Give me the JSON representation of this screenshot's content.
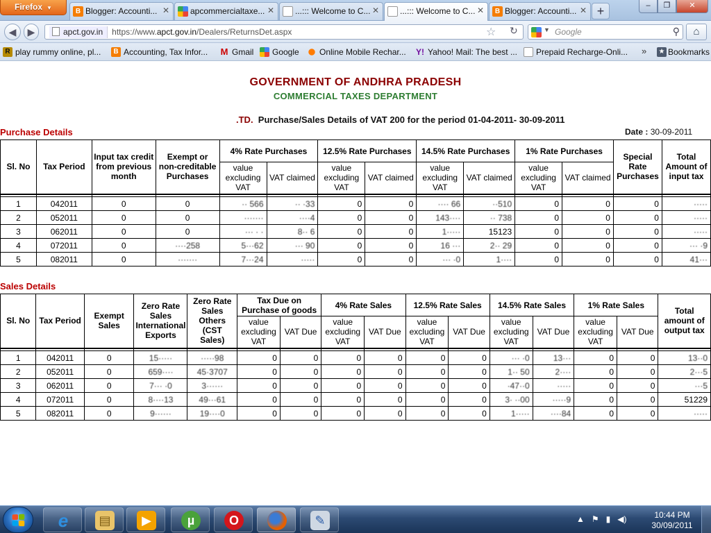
{
  "browser": {
    "app_button": "Firefox",
    "tabs": [
      {
        "label": "Blogger: Accounti...",
        "icon": "blogger-icon",
        "close": "✕"
      },
      {
        "label": "apcommercialtaxe...",
        "icon": "google-icon",
        "close": "✕"
      },
      {
        "label": "...::: Welcome to C...",
        "icon": "page-icon",
        "close": "✕"
      },
      {
        "label": "...::: Welcome to C...",
        "icon": "page-icon",
        "close": "✕",
        "active": true
      },
      {
        "label": "Blogger: Accounti...",
        "icon": "blogger-icon",
        "close": "✕"
      }
    ],
    "new_tab": "+",
    "site_identity": "apct.gov.in",
    "url_prefix": "https://www.",
    "url_domain": "apct.gov.in",
    "url_path": "/Dealers/ReturnsDet.aspx",
    "search_placeholder": "Google",
    "bookmarks": [
      {
        "label": "play rummy online, pl...",
        "icon": "R"
      },
      {
        "label": "Accounting, Tax Infor...",
        "icon": "B"
      },
      {
        "label": "Gmail",
        "icon": "M"
      },
      {
        "label": "Google",
        "icon": "g"
      },
      {
        "label": "Online Mobile Rechar...",
        "icon": "o"
      },
      {
        "label": "Yahoo! Mail: The best ...",
        "icon": "Y!"
      },
      {
        "label": "Prepaid Recharge-Onli...",
        "icon": "pg"
      }
    ],
    "bookmarks_overflow": "»",
    "bookmarks_menu": "Bookmarks"
  },
  "page": {
    "gov_title": "GOVERNMENT OF ANDHRA PRADESH",
    "dept_title": "COMMERCIAL TAXES DEPARTMENT",
    "dealer_suffix": ".TD.",
    "period_text": "Purchase/Sales Details of VAT 200 for the period 01-04-2011- 30-09-2011",
    "date_label": "Date :",
    "date_value": "30-09-2011",
    "purchase": {
      "title": "Purchase Details",
      "headers": {
        "sl": "Sl. No",
        "period": "Tax Period",
        "itc": "Input tax credit from previous month",
        "exempt": "Exempt or non-creditable Purchases",
        "r4": "4% Rate Purchases",
        "r125": "12.5% Rate Purchases",
        "r145": "14.5% Rate Purchases",
        "r1": "1% Rate Purchases",
        "special": "Special Rate Purchases",
        "total": "Total Amount of input tax",
        "value": "value excluding VAT",
        "vat": "VAT claimed"
      },
      "rows": [
        [
          "1",
          "042011",
          "0",
          "0",
          "·· 566",
          "·· ·33",
          "0",
          "0",
          "···· 66",
          "··510",
          "0",
          "0",
          "0",
          "·····"
        ],
        [
          "2",
          "052011",
          "0",
          "0",
          "·······",
          "····4",
          "0",
          "0",
          "143····",
          "·· 738",
          "0",
          "0",
          "0",
          "·····"
        ],
        [
          "3",
          "062011",
          "0",
          "0",
          "··· · ·",
          "8·· 6",
          "0",
          "0",
          "1·····",
          "15123",
          "0",
          "0",
          "0",
          "·····"
        ],
        [
          "4",
          "072011",
          "0",
          "····258",
          "5···62",
          "··· 90",
          "0",
          "0",
          "16 ···",
          "2·· 29",
          "0",
          "0",
          "0",
          "··· ·9"
        ],
        [
          "5",
          "082011",
          "0",
          "·······",
          "7···24",
          "·····",
          "0",
          "0",
          "··· ·0",
          "1····",
          "0",
          "0",
          "0",
          "41···"
        ]
      ]
    },
    "sales": {
      "title": "Sales Details",
      "headers": {
        "sl": "Sl. No",
        "period": "Tax Period",
        "exempt": "Exempt Sales",
        "zero_intl": "Zero Rate Sales International Exports",
        "zero_other": "Zero Rate Sales Others (CST Sales)",
        "tax_due_goods": "Tax Due on Purchase of goods",
        "r4": "4% Rate Sales",
        "r125": "12.5% Rate Sales",
        "r145": "14.5% Rate Sales",
        "r1": "1% Rate Sales",
        "total": "Total amount of output tax",
        "value": "value excluding VAT",
        "vat": "VAT Due"
      },
      "rows": [
        [
          "1",
          "042011",
          "0",
          "15·····",
          "·····98",
          "0",
          "0",
          "0",
          "0",
          "0",
          "0",
          "··· ·0",
          "13···",
          "0",
          "0",
          "13··0"
        ],
        [
          "2",
          "052011",
          "0",
          "659····",
          "45·3707",
          "0",
          "0",
          "0",
          "0",
          "0",
          "0",
          "1·· 50",
          "2····",
          "0",
          "0",
          "2···5"
        ],
        [
          "3",
          "062011",
          "0",
          "7··· ·0",
          "3······",
          "0",
          "0",
          "0",
          "0",
          "0",
          "0",
          "·47··0",
          "·····",
          "0",
          "0",
          "···5"
        ],
        [
          "4",
          "072011",
          "0",
          "8····13",
          "49···61",
          "0",
          "0",
          "0",
          "0",
          "0",
          "0",
          "3· ··00",
          "·····9",
          "0",
          "0",
          "51229"
        ],
        [
          "5",
          "082011",
          "0",
          "9······",
          "19····0",
          "0",
          "0",
          "0",
          "0",
          "0",
          "0",
          "1·····",
          "····84",
          "0",
          "0",
          "·····"
        ]
      ]
    }
  },
  "taskbar": {
    "apps": [
      {
        "name": "internet-explorer",
        "glyph": "e"
      },
      {
        "name": "file-explorer",
        "glyph": "▤"
      },
      {
        "name": "media-player",
        "glyph": "▶"
      },
      {
        "name": "utorrent",
        "glyph": "µ"
      },
      {
        "name": "opera",
        "glyph": "O"
      },
      {
        "name": "firefox",
        "glyph": "●"
      },
      {
        "name": "paint",
        "glyph": "✎"
      }
    ],
    "time": "10:44 PM",
    "date": "30/09/2011"
  },
  "colors": {
    "gov_title": "#8b0000",
    "dept_title": "#2e7d32",
    "section_title": "#bb0000",
    "firefox_orange": "#e4661a"
  }
}
